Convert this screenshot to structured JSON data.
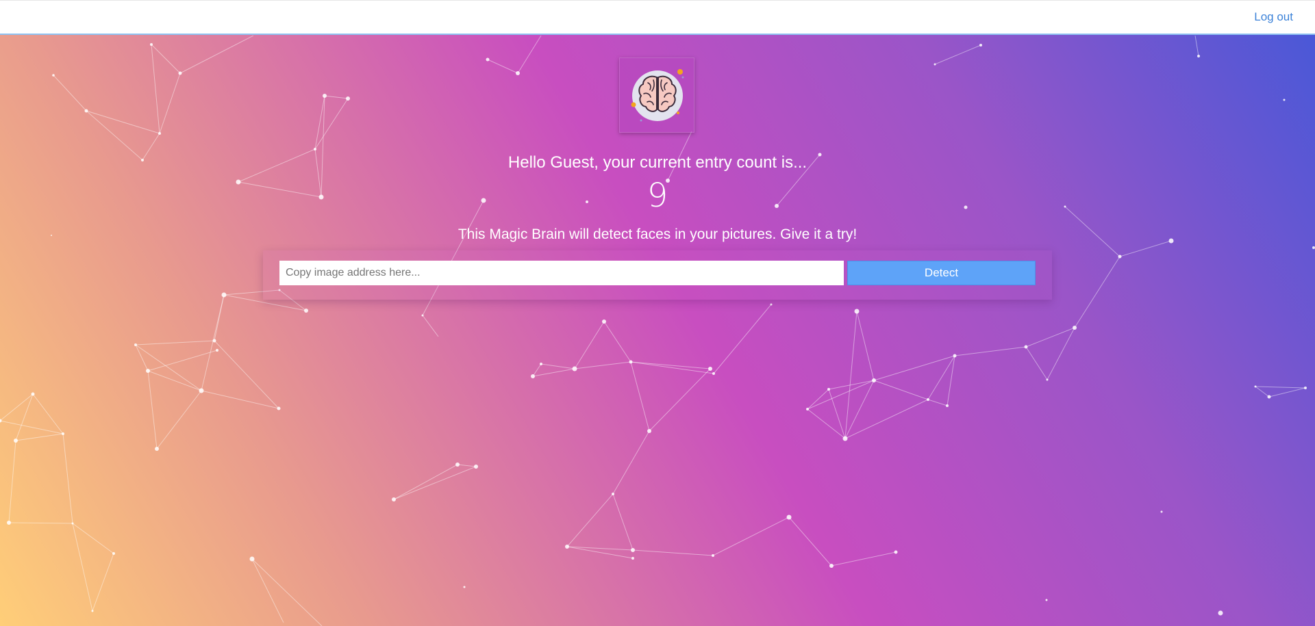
{
  "header": {
    "logout_label": "Log out"
  },
  "greeting": {
    "text": "Hello Guest, your current entry count is..."
  },
  "entry": {
    "count": "9"
  },
  "intro": {
    "text": "This Magic Brain will detect faces in your pictures. Give it a try!"
  },
  "form": {
    "input_placeholder": "Copy image address here...",
    "detect_label": "Detect"
  },
  "logo": {
    "icon": "brain-icon"
  },
  "colors": {
    "gradient_start": "#ffce78",
    "gradient_mid": "#c84ec0",
    "gradient_end": "#4658d8",
    "link": "#3c82d8",
    "button": "#5ea3f8"
  }
}
